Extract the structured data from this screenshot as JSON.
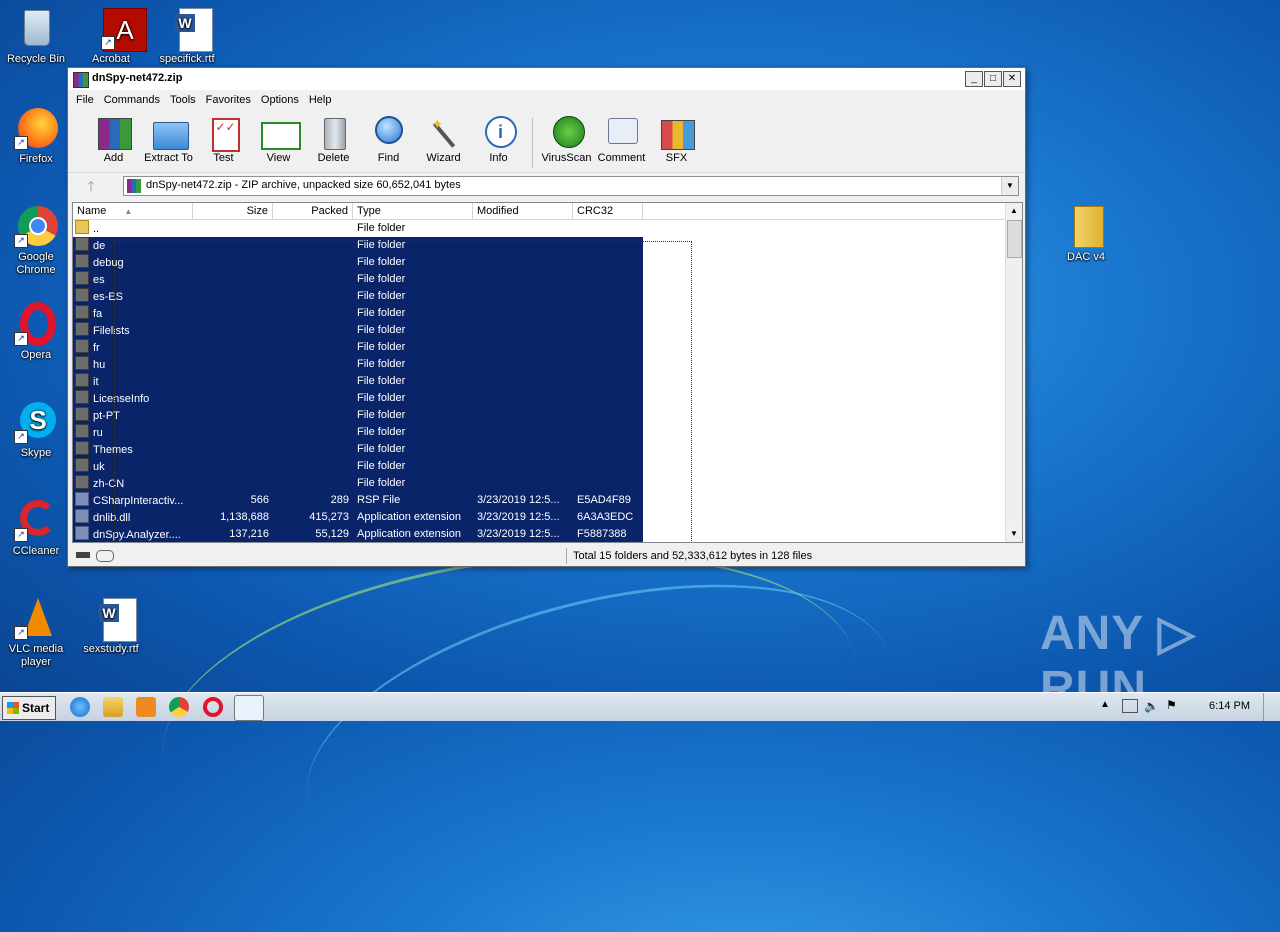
{
  "desktop": {
    "icons": [
      {
        "label": "Recycle Bin"
      },
      {
        "label": "Acrobat"
      },
      {
        "label": "specifick.rtf"
      },
      {
        "label": "Firefox"
      },
      {
        "label": "Google Chrome"
      },
      {
        "label": "Opera"
      },
      {
        "label": "Skype"
      },
      {
        "label": "CCleaner"
      },
      {
        "label": "VLC media player"
      },
      {
        "label": "sexstudy.rtf"
      },
      {
        "label": "DAC v4"
      }
    ],
    "watermark": "ANY ▷ RUN"
  },
  "window": {
    "title": "dnSpy-net472.zip",
    "menu": [
      "File",
      "Commands",
      "Tools",
      "Favorites",
      "Options",
      "Help"
    ],
    "toolbar": [
      "Add",
      "Extract To",
      "Test",
      "View",
      "Delete",
      "Find",
      "Wizard",
      "Info",
      "VirusScan",
      "Comment",
      "SFX"
    ],
    "address": "dnSpy-net472.zip - ZIP archive, unpacked size 60,652,041 bytes",
    "columns": [
      "Name",
      "Size",
      "Packed",
      "Type",
      "Modified",
      "CRC32"
    ],
    "rows": [
      {
        "name": "..",
        "size": "",
        "packed": "",
        "type": "File folder",
        "modified": "",
        "crc": ""
      },
      {
        "name": "de",
        "size": "",
        "packed": "",
        "type": "File folder",
        "modified": "",
        "crc": ""
      },
      {
        "name": "debug",
        "size": "",
        "packed": "",
        "type": "File folder",
        "modified": "",
        "crc": ""
      },
      {
        "name": "es",
        "size": "",
        "packed": "",
        "type": "File folder",
        "modified": "",
        "crc": ""
      },
      {
        "name": "es-ES",
        "size": "",
        "packed": "",
        "type": "File folder",
        "modified": "",
        "crc": ""
      },
      {
        "name": "fa",
        "size": "",
        "packed": "",
        "type": "File folder",
        "modified": "",
        "crc": ""
      },
      {
        "name": "Filelists",
        "size": "",
        "packed": "",
        "type": "File folder",
        "modified": "",
        "crc": ""
      },
      {
        "name": "fr",
        "size": "",
        "packed": "",
        "type": "File folder",
        "modified": "",
        "crc": ""
      },
      {
        "name": "hu",
        "size": "",
        "packed": "",
        "type": "File folder",
        "modified": "",
        "crc": ""
      },
      {
        "name": "it",
        "size": "",
        "packed": "",
        "type": "File folder",
        "modified": "",
        "crc": ""
      },
      {
        "name": "LicenseInfo",
        "size": "",
        "packed": "",
        "type": "File folder",
        "modified": "",
        "crc": ""
      },
      {
        "name": "pt-PT",
        "size": "",
        "packed": "",
        "type": "File folder",
        "modified": "",
        "crc": ""
      },
      {
        "name": "ru",
        "size": "",
        "packed": "",
        "type": "File folder",
        "modified": "",
        "crc": ""
      },
      {
        "name": "Themes",
        "size": "",
        "packed": "",
        "type": "File folder",
        "modified": "",
        "crc": ""
      },
      {
        "name": "uk",
        "size": "",
        "packed": "",
        "type": "File folder",
        "modified": "",
        "crc": ""
      },
      {
        "name": "zh-CN",
        "size": "",
        "packed": "",
        "type": "File folder",
        "modified": "",
        "crc": ""
      },
      {
        "name": "CSharpInteractiv...",
        "size": "566",
        "packed": "289",
        "type": "RSP File",
        "modified": "3/23/2019 12:5...",
        "crc": "E5AD4F89"
      },
      {
        "name": "dnlib.dll",
        "size": "1,138,688",
        "packed": "415,273",
        "type": "Application extension",
        "modified": "3/23/2019 12:5...",
        "crc": "6A3A3EDC"
      },
      {
        "name": "dnSpy.Analyzer....",
        "size": "137,216",
        "packed": "55,129",
        "type": "Application extension",
        "modified": "3/23/2019 12:5...",
        "crc": "F5887388"
      }
    ],
    "status": "Total 15 folders and 52,333,612 bytes in 128 files"
  },
  "taskbar": {
    "start": "Start",
    "clock": "6:14 PM"
  }
}
